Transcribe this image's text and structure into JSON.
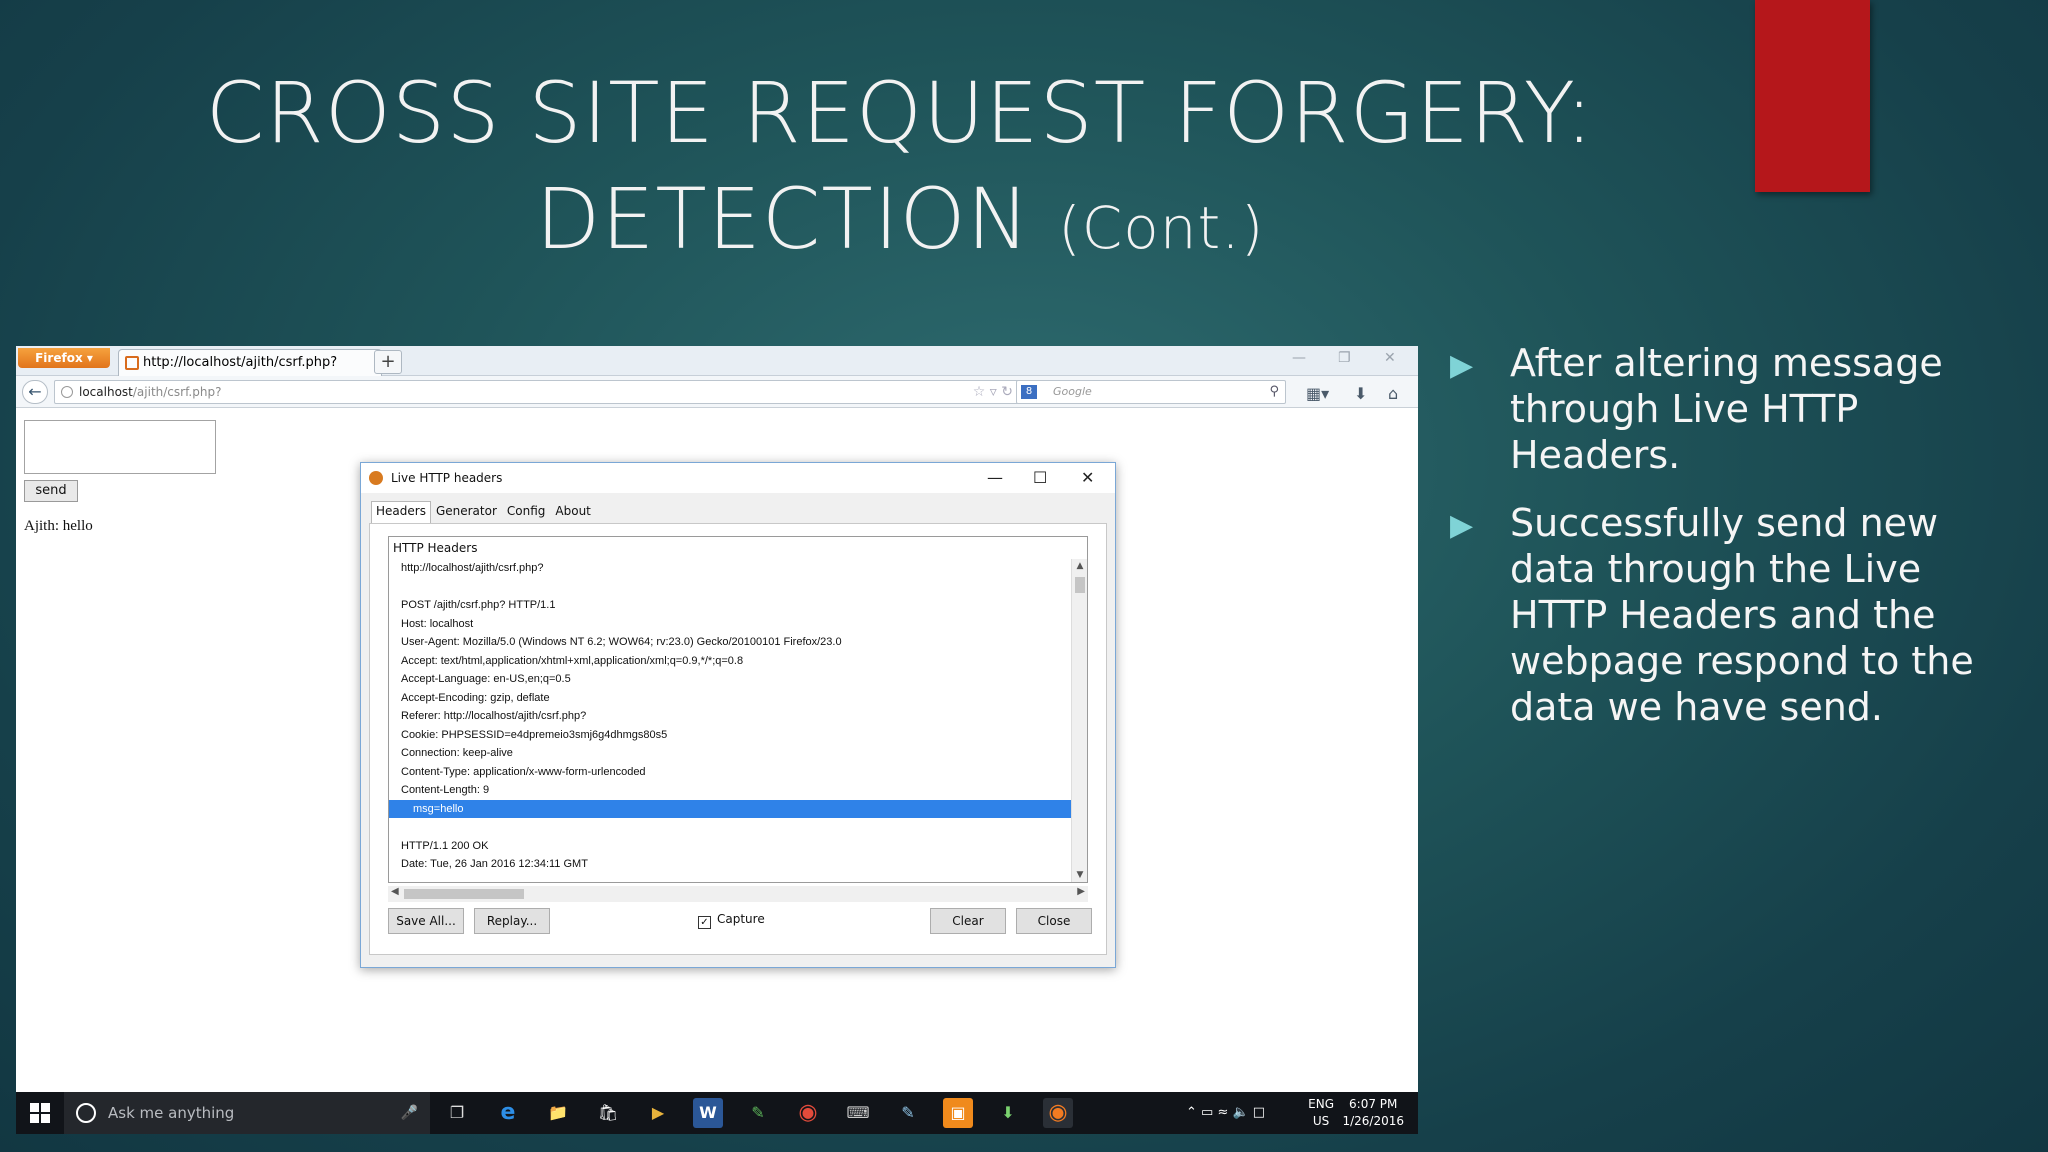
{
  "slide": {
    "title_line1": "CROSS SITE REQUEST FORGERY:",
    "title_line2": "DETECTION",
    "title_cont": "(Cont.)",
    "bullets": [
      "After altering message through Live HTTP Headers.",
      "Successfully send new data through the Live HTTP Headers and the webpage respond to the data we have send."
    ],
    "accent_color": "#b5171b"
  },
  "browser": {
    "app_button": "Firefox",
    "tab_title": "http://localhost/ajith/csrf.php?",
    "new_tab": "+",
    "url_host": "localhost",
    "url_path": "/ajith/csrf.php?",
    "search_placeholder": "Google",
    "page": {
      "send_label": "send",
      "output_text": "Ajith: hello"
    }
  },
  "dialog": {
    "title": "Live HTTP headers",
    "tabs": [
      "Headers",
      "Generator",
      "Config",
      "About"
    ],
    "active_tab": "Headers",
    "box_title": "HTTP Headers",
    "lines": [
      "http://localhost/ajith/csrf.php?",
      "",
      "POST /ajith/csrf.php? HTTP/1.1",
      "Host: localhost",
      "User-Agent: Mozilla/5.0 (Windows NT 6.2; WOW64; rv:23.0) Gecko/20100101 Firefox/23.0",
      "Accept: text/html,application/xhtml+xml,application/xml;q=0.9,*/*;q=0.8",
      "Accept-Language: en-US,en;q=0.5",
      "Accept-Encoding: gzip, deflate",
      "Referer: http://localhost/ajith/csrf.php?",
      "Cookie: PHPSESSID=e4dpremeio3smj6g4dhmgs80s5",
      "Connection: keep-alive",
      "Content-Type: application/x-www-form-urlencoded",
      "Content-Length: 9",
      "msg=hello",
      "",
      "HTTP/1.1 200 OK",
      "Date: Tue, 26 Jan 2016 12:34:11 GMT"
    ],
    "selected_line_index": 13,
    "buttons": {
      "save_all": "Save All...",
      "replay": "Replay...",
      "capture": "Capture",
      "clear": "Clear",
      "close": "Close"
    },
    "capture_checked": true
  },
  "taskbar": {
    "search_placeholder": "Ask me anything",
    "lang_top": "ENG",
    "lang_bottom": "US",
    "time": "6:07 PM",
    "date": "1/26/2016"
  }
}
